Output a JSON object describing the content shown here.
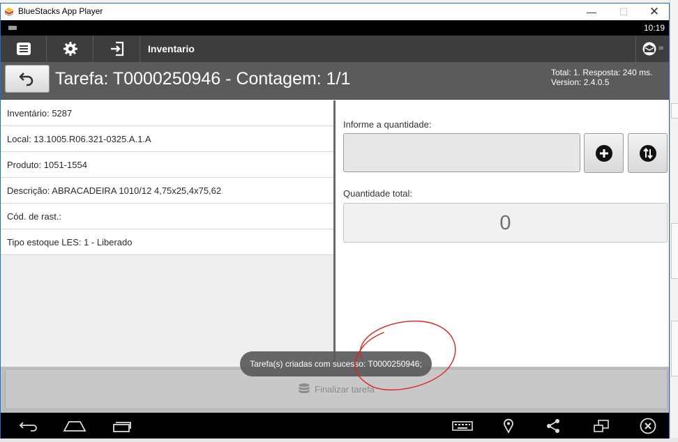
{
  "window": {
    "title": "BlueStacks App Player",
    "minimize": "—",
    "maximize": "☐",
    "close": "✕"
  },
  "status_bar": {
    "time": "10:19"
  },
  "toolbar": {
    "title": "Inventario",
    "buttons": [
      "list-icon",
      "gear-icon",
      "login-icon"
    ],
    "notification_icon": "mail-icon",
    "notification_badge": "38"
  },
  "header": {
    "title": "Tarefa: T0000250946 - Contagem: 1/1",
    "info_line1": "Total: 1. Resposta: 240 ms.",
    "info_line2": "Version: 2.4.0.5"
  },
  "details": [
    "Inventário: 5287",
    "Local: 13.1005.R06.321-0325.A.1.A",
    "Produto: 1051-1554",
    "Descrição: ABRACADEIRA 1010/12 4,75x25,4x75,62",
    "Cód. de rast.:",
    "Tipo estoque LES: 1 - Liberado"
  ],
  "form": {
    "quantity_label": "Informe a quantidade:",
    "quantity_value": "",
    "total_label": "Quantidade total:",
    "total_value": "0"
  },
  "finalize_button": {
    "label": "Finalizar tarefa"
  },
  "toast": {
    "message": "Tarefa(s) criadas com sucesso: T0000250946;"
  },
  "colors": {
    "toolbar": "#3d3d3d",
    "header": "#5b5b5b",
    "annotation": "#e0201c",
    "window_border": "#1f6fc5"
  }
}
